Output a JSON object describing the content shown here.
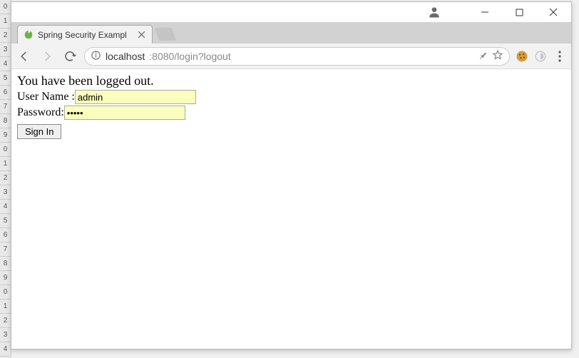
{
  "window": {
    "tab_title": "Spring Security Exampl",
    "user_tooltip": "Account"
  },
  "nav": {
    "back_tooltip": "Back",
    "forward_tooltip": "Forward",
    "reload_tooltip": "Reload"
  },
  "address": {
    "host": "localhost",
    "port_path": ":8080/login?logout",
    "info_tooltip": "View site information",
    "pin_tooltip": "Bookmark",
    "star_tooltip": "Bookmark this page"
  },
  "extensions": {
    "cookie_name": "cookie-extension",
    "grey_name": "extension-disabled"
  },
  "menu_tooltip": "Customize and control",
  "page": {
    "logout_message": "You have been logged out.",
    "username_label": "User Name : ",
    "username_value": "admin",
    "password_label": "Password: ",
    "password_value": "•••••",
    "signin_label": "Sign In"
  },
  "rows": [
    "0",
    "1",
    "2",
    "3",
    "4",
    "5",
    "6",
    "7",
    "8",
    "9",
    "0",
    "1",
    "2",
    "3",
    "4",
    "5",
    "6",
    "7",
    "8",
    "9",
    "0",
    "1",
    "2",
    "3",
    "4"
  ]
}
